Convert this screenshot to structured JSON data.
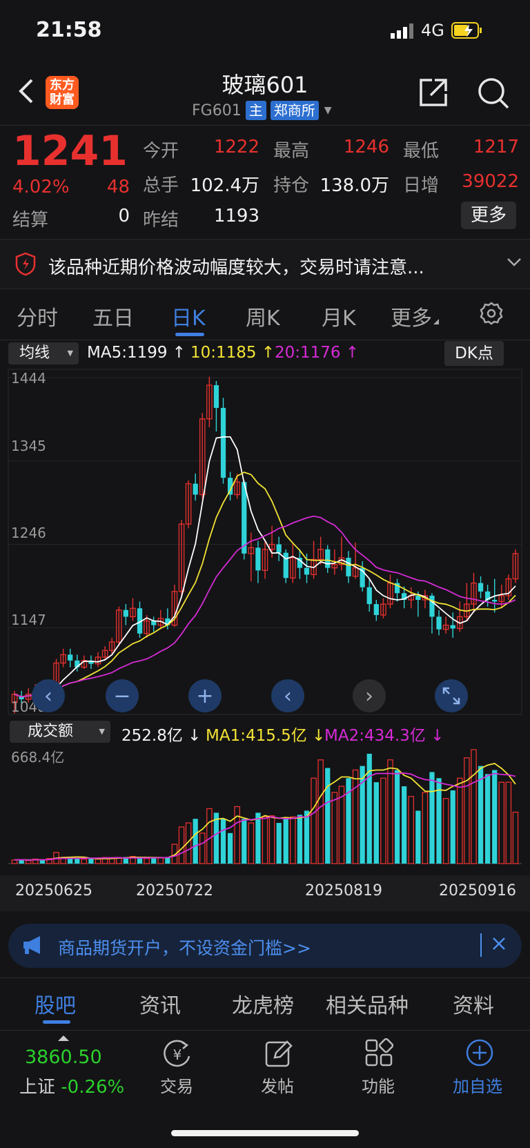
{
  "status_bar": {
    "time": "21:58",
    "network": "4G"
  },
  "header": {
    "logo_line1": "东方",
    "logo_line2": "财富",
    "title": "玻璃601",
    "code": "FG601",
    "badge_main": "主",
    "badge_exchange": "郑商所"
  },
  "quote": {
    "price": "1241",
    "change_pct": "4.02%",
    "change_amt": "48",
    "open_label": "今开",
    "open": "1222",
    "high_label": "最高",
    "high": "1246",
    "low_label": "最低",
    "low": "1217",
    "volume_label": "总手",
    "volume": "102.4万",
    "oi_label": "持仓",
    "oi": "138.0万",
    "daily_inc_label": "日增",
    "daily_inc": "39022",
    "settle_label": "结算",
    "settle": "0",
    "prev_settle_label": "昨结",
    "prev_settle": "1193",
    "more_label": "更多"
  },
  "notice": {
    "text": "该品种近期价格波动幅度较大，交易时请注意..."
  },
  "period_tabs": [
    "分时",
    "五日",
    "日K",
    "周K",
    "月K",
    "更多"
  ],
  "ma_bar": {
    "selector": "均线",
    "ma5": "MA5:1199",
    "ma10": "10:1185",
    "ma20": "20:1176",
    "dk": "DK点"
  },
  "price_axis": [
    "1444",
    "1345",
    "1246",
    "1147",
    "1048"
  ],
  "vol_bar": {
    "selector": "成交额",
    "value": "252.8亿",
    "ma1": "MA1:415.5亿",
    "ma2": "MA2:434.3亿"
  },
  "vol_axis_max": "668.4亿",
  "date_labels": [
    "20250625",
    "20250722",
    "20250819",
    "20250916"
  ],
  "promo": {
    "text": "商品期货开户，不设资金门槛>>"
  },
  "bottom_tabs": [
    "股吧",
    "资讯",
    "龙虎榜",
    "相关品种",
    "资料"
  ],
  "footer": {
    "index_value": "3860.50",
    "index_name": "上证",
    "index_change": "-0.26%",
    "nav": [
      "交易",
      "发帖",
      "功能",
      "加自选"
    ]
  },
  "colors": {
    "up": "#e8312f",
    "down": "#2fd3d8",
    "ma5": "#ffffff",
    "ma10": "#f2e335",
    "ma20": "#d62bd6",
    "accent": "#3f7fe0"
  },
  "chart_data": {
    "type": "candlestick",
    "y_range": [
      1048,
      1444
    ],
    "candles": [
      [
        1058,
        1068,
        1045,
        1072
      ],
      [
        1066,
        1062,
        1055,
        1072
      ],
      [
        1062,
        1068,
        1058,
        1075
      ],
      [
        1068,
        1070,
        1060,
        1080
      ],
      [
        1070,
        1060,
        1055,
        1078
      ],
      [
        1060,
        1075,
        1055,
        1080
      ],
      [
        1075,
        1105,
        1072,
        1110
      ],
      [
        1105,
        1115,
        1100,
        1122
      ],
      [
        1115,
        1108,
        1100,
        1122
      ],
      [
        1108,
        1100,
        1095,
        1115
      ],
      [
        1100,
        1108,
        1098,
        1114
      ],
      [
        1108,
        1104,
        1098,
        1114
      ],
      [
        1104,
        1112,
        1100,
        1118
      ],
      [
        1112,
        1120,
        1108,
        1125
      ],
      [
        1120,
        1130,
        1114,
        1135
      ],
      [
        1130,
        1168,
        1125,
        1172
      ],
      [
        1168,
        1160,
        1150,
        1175
      ],
      [
        1160,
        1170,
        1155,
        1182
      ],
      [
        1170,
        1140,
        1135,
        1178
      ],
      [
        1140,
        1155,
        1135,
        1162
      ],
      [
        1155,
        1150,
        1142,
        1160
      ],
      [
        1150,
        1158,
        1145,
        1168
      ],
      [
        1158,
        1150,
        1145,
        1170
      ],
      [
        1150,
        1190,
        1148,
        1198
      ],
      [
        1190,
        1270,
        1185,
        1275
      ],
      [
        1270,
        1318,
        1265,
        1322
      ],
      [
        1318,
        1305,
        1298,
        1330
      ],
      [
        1305,
        1395,
        1300,
        1402
      ],
      [
        1395,
        1435,
        1385,
        1445
      ],
      [
        1435,
        1408,
        1380,
        1440
      ],
      [
        1408,
        1325,
        1318,
        1420
      ],
      [
        1325,
        1305,
        1298,
        1332
      ],
      [
        1305,
        1320,
        1300,
        1330
      ],
      [
        1320,
        1235,
        1228,
        1322
      ],
      [
        1235,
        1242,
        1202,
        1260
      ],
      [
        1242,
        1215,
        1200,
        1250
      ],
      [
        1215,
        1240,
        1205,
        1250
      ],
      [
        1240,
        1246,
        1230,
        1268
      ],
      [
        1246,
        1236,
        1226,
        1255
      ],
      [
        1236,
        1206,
        1200,
        1240
      ],
      [
        1206,
        1230,
        1200,
        1248
      ],
      [
        1230,
        1218,
        1205,
        1240
      ],
      [
        1218,
        1210,
        1200,
        1235
      ],
      [
        1210,
        1228,
        1205,
        1250
      ],
      [
        1228,
        1240,
        1222,
        1255
      ],
      [
        1240,
        1218,
        1212,
        1245
      ],
      [
        1218,
        1222,
        1210,
        1240
      ],
      [
        1222,
        1230,
        1215,
        1255
      ],
      [
        1230,
        1208,
        1200,
        1238
      ],
      [
        1208,
        1218,
        1205,
        1248
      ],
      [
        1218,
        1195,
        1190,
        1226
      ],
      [
        1195,
        1175,
        1166,
        1205
      ],
      [
        1175,
        1162,
        1155,
        1180
      ],
      [
        1162,
        1175,
        1158,
        1182
      ],
      [
        1175,
        1200,
        1170,
        1210
      ],
      [
        1200,
        1188,
        1178,
        1205
      ],
      [
        1188,
        1180,
        1170,
        1196
      ],
      [
        1180,
        1185,
        1170,
        1195
      ],
      [
        1185,
        1180,
        1160,
        1190
      ],
      [
        1180,
        1185,
        1170,
        1192
      ],
      [
        1185,
        1160,
        1140,
        1188
      ],
      [
        1160,
        1145,
        1138,
        1168
      ],
      [
        1145,
        1150,
        1140,
        1160
      ],
      [
        1150,
        1146,
        1135,
        1165
      ],
      [
        1146,
        1160,
        1142,
        1178
      ],
      [
        1160,
        1175,
        1155,
        1200
      ],
      [
        1175,
        1200,
        1165,
        1212
      ],
      [
        1200,
        1190,
        1182,
        1208
      ],
      [
        1190,
        1180,
        1172,
        1198
      ],
      [
        1180,
        1178,
        1165,
        1205
      ],
      [
        1178,
        1185,
        1170,
        1198
      ],
      [
        1185,
        1205,
        1180,
        1210
      ],
      [
        1205,
        1235,
        1200,
        1240
      ]
    ],
    "volume_series": [
      18,
      20,
      15,
      22,
      18,
      25,
      55,
      30,
      28,
      25,
      22,
      24,
      22,
      30,
      28,
      30,
      32,
      35,
      30,
      25,
      28,
      30,
      32,
      95,
      180,
      200,
      220,
      150,
      270,
      250,
      220,
      150,
      280,
      220,
      200,
      250,
      230,
      235,
      200,
      220,
      230,
      240,
      260,
      420,
      510,
      470,
      350,
      380,
      420,
      460,
      480,
      540,
      400,
      420,
      510,
      460,
      380,
      330,
      260,
      350,
      450,
      420,
      320,
      360,
      420,
      520,
      560,
      480,
      440,
      460,
      400,
      400,
      252.8
    ]
  }
}
